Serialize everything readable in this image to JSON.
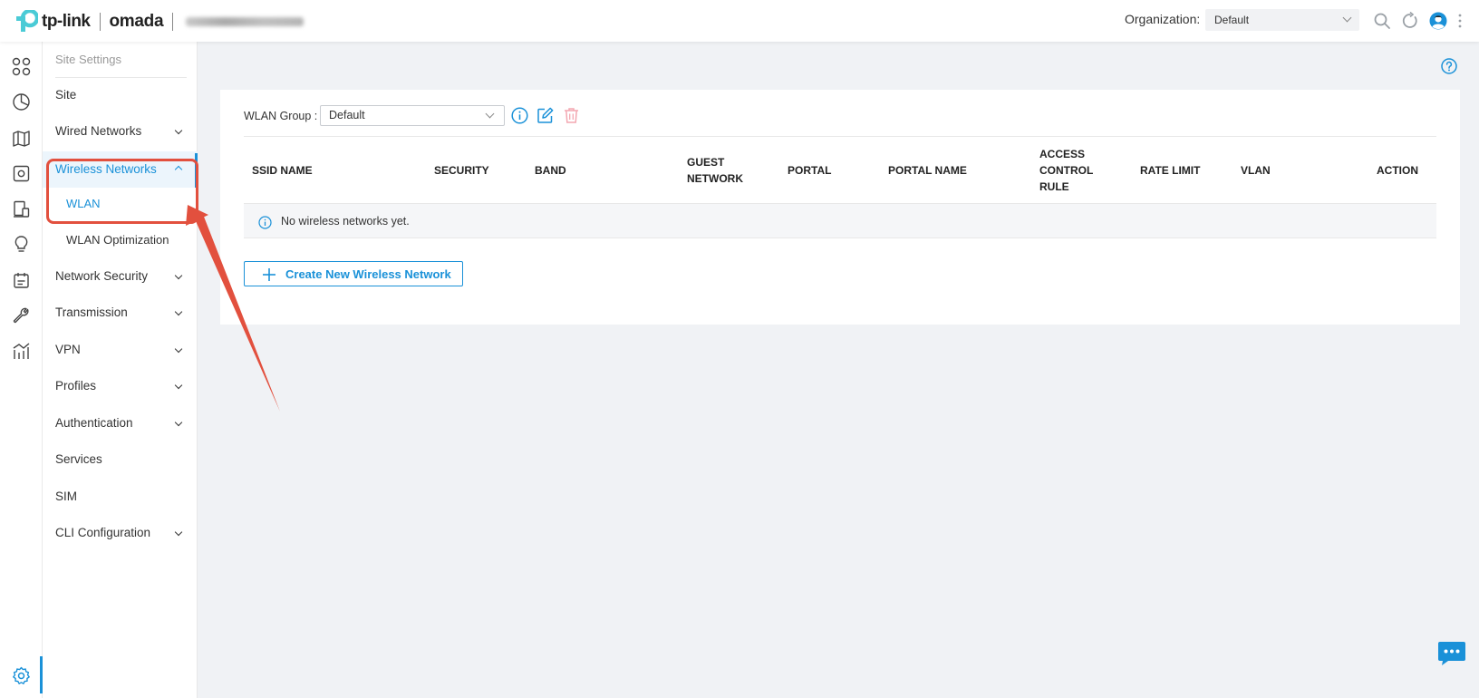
{
  "header": {
    "brand": "tp-link",
    "product": "omada",
    "org_label": "Organization:",
    "org_value": "Default"
  },
  "rail": {
    "icons": [
      "dashboard-icon",
      "statistics-icon",
      "map-icon",
      "devices-icon",
      "clients-icon",
      "insights-icon",
      "logs-icon",
      "tools-icon",
      "reports-icon"
    ],
    "active": "settings-icon"
  },
  "sidebar": {
    "heading": "Site Settings",
    "items": [
      {
        "label": "Site",
        "expandable": false
      },
      {
        "label": "Wired Networks",
        "expandable": true
      },
      {
        "label": "Wireless Networks",
        "expandable": true,
        "open": true
      },
      {
        "label": "Network Security",
        "expandable": true
      },
      {
        "label": "Transmission",
        "expandable": true
      },
      {
        "label": "VPN",
        "expandable": true
      },
      {
        "label": "Profiles",
        "expandable": true
      },
      {
        "label": "Authentication",
        "expandable": true
      },
      {
        "label": "Services",
        "expandable": false
      },
      {
        "label": "SIM",
        "expandable": false
      },
      {
        "label": "CLI Configuration",
        "expandable": true
      }
    ],
    "subitems": [
      {
        "label": "WLAN",
        "active": true
      },
      {
        "label": "WLAN Optimization",
        "active": false
      }
    ]
  },
  "main": {
    "wlan_group_label": "WLAN Group :",
    "wlan_group_value": "Default",
    "columns": [
      {
        "label": "SSID NAME"
      },
      {
        "label": "SECURITY"
      },
      {
        "label": "BAND"
      },
      {
        "label": "GUEST NETWORK"
      },
      {
        "label": "PORTAL"
      },
      {
        "label": "PORTAL NAME"
      },
      {
        "label": "ACCESS CONTROL RULE"
      },
      {
        "label": "RATE LIMIT"
      },
      {
        "label": "VLAN"
      },
      {
        "label": "ACTION"
      }
    ],
    "empty_message": "No wireless networks yet.",
    "create_button": "Create New Wireless Network"
  },
  "colors": {
    "accent": "#1a91d8",
    "annotation": "#e2503e",
    "delete_disabled": "#f3a7b1",
    "background": "#f0f2f5"
  }
}
